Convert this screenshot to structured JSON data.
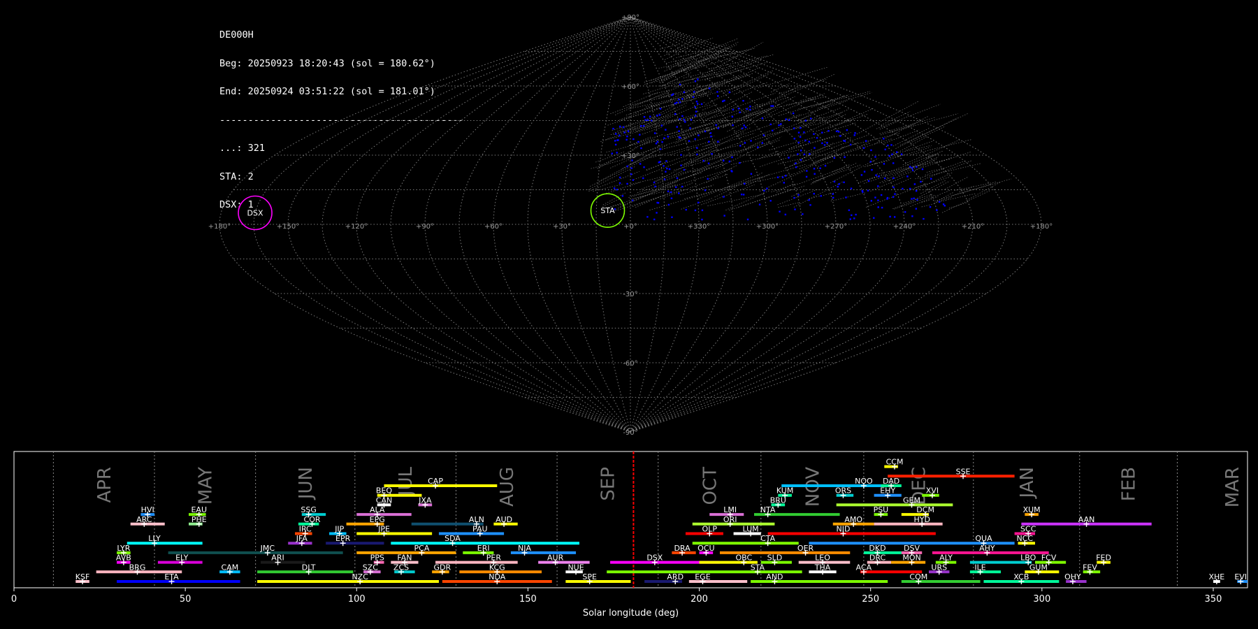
{
  "info": {
    "station": "DE000H",
    "beg": "Beg: 20250923 18:20:43 (sol = 180.62°)",
    "end": "End: 20250924 03:51:22 (sol = 181.01°)",
    "separator": "-------------------------------------------",
    "counts": [
      "...: 321",
      "STA: 2",
      "DSX: 1"
    ]
  },
  "sky_map": {
    "projection": "sinusoidal",
    "lon_labels": [
      "+180°",
      "+150°",
      "+120°",
      "+90°",
      "+60°",
      "+30°",
      "+0°",
      "+330°",
      "+300°",
      "+270°",
      "+240°",
      "+210°",
      "+180°"
    ],
    "lat_labels": [
      "+90°",
      "+60°",
      "+30°",
      "-30°",
      "-60°",
      "-90°"
    ],
    "radiants": [
      {
        "name": "DSX",
        "lon": 165,
        "lat": 5,
        "color": "#ff00ff"
      },
      {
        "name": "STA",
        "lon": 10,
        "lat": 6,
        "color": "#7fff00"
      }
    ],
    "colors": {
      "sporadic_meteor": "#0000ff",
      "grid": "#888888",
      "trail": "#999999"
    }
  },
  "chart_data": {
    "type": "timeline",
    "xlabel": "Solar longitude (deg)",
    "xlim": [
      0,
      360
    ],
    "xticks": [
      0,
      50,
      100,
      150,
      200,
      250,
      300,
      350
    ],
    "current_sol": 180.8,
    "months": [
      {
        "label": "APR",
        "start": 11.5
      },
      {
        "label": "MAY",
        "start": 41
      },
      {
        "label": "JUN",
        "start": 70.5
      },
      {
        "label": "JUL",
        "start": 99.5
      },
      {
        "label": "AUG",
        "start": 129
      },
      {
        "label": "SEP",
        "start": 158.5
      },
      {
        "label": "OCT",
        "start": 188
      },
      {
        "label": "NOV",
        "start": 218
      },
      {
        "label": "DEC",
        "start": 248
      },
      {
        "label": "JAN",
        "start": 280
      },
      {
        "label": "FEB",
        "start": 311
      },
      {
        "label": "MAR",
        "start": 339.5
      }
    ],
    "showers": [
      {
        "name": "KSF",
        "start": 18,
        "end": 22,
        "peak": 20,
        "row": 0,
        "color": "#ffc0cb"
      },
      {
        "name": "ETA",
        "start": 30,
        "end": 66,
        "peak": 46,
        "row": 0,
        "color": "#0000ff"
      },
      {
        "name": "NZC",
        "start": 71,
        "end": 124,
        "peak": 101,
        "row": 0,
        "color": "#ffff00"
      },
      {
        "name": "NDA",
        "start": 125,
        "end": 157,
        "peak": 141,
        "row": 0,
        "color": "#ff4500"
      },
      {
        "name": "SPE",
        "start": 161,
        "end": 180,
        "peak": 168,
        "row": 0,
        "color": "#ffff00"
      },
      {
        "name": "ARD",
        "start": 184,
        "end": 195,
        "peak": 193,
        "row": 0,
        "color": "#191970"
      },
      {
        "name": "EGE",
        "start": 197,
        "end": 214,
        "peak": 201,
        "row": 0,
        "color": "#ffc0cb"
      },
      {
        "name": "AND",
        "start": 215,
        "end": 255,
        "peak": 222,
        "row": 0,
        "color": "#7cfc00"
      },
      {
        "name": "COM",
        "start": 259,
        "end": 282,
        "peak": 264,
        "row": 0,
        "color": "#32cd32"
      },
      {
        "name": "XCB",
        "start": 283,
        "end": 305,
        "peak": 294,
        "row": 0,
        "color": "#00fa9a"
      },
      {
        "name": "OHY",
        "start": 307,
        "end": 313,
        "peak": 309,
        "row": 0,
        "color": "#9932cc"
      },
      {
        "name": "XHE",
        "start": 350,
        "end": 352,
        "peak": 351,
        "row": 0,
        "color": "#ffffff"
      },
      {
        "name": "EVI",
        "start": 357,
        "end": 360,
        "peak": 358,
        "row": 0,
        "color": "#1e90ff"
      },
      {
        "name": "BRG",
        "start": 24,
        "end": 49,
        "peak": 36,
        "row": 1,
        "color": "#ffb6c1"
      },
      {
        "name": "CAM",
        "start": 60,
        "end": 66,
        "peak": 63,
        "row": 1,
        "color": "#00bfff"
      },
      {
        "name": "DLT",
        "start": 71,
        "end": 99,
        "peak": 86,
        "row": 1,
        "color": "#32cd32"
      },
      {
        "name": "SZC",
        "start": 102,
        "end": 107,
        "peak": 104,
        "row": 1,
        "color": "#da70d6"
      },
      {
        "name": "ZCS",
        "start": 111,
        "end": 117,
        "peak": 113,
        "row": 1,
        "color": "#00ced1"
      },
      {
        "name": "GDR",
        "start": 122,
        "end": 127,
        "peak": 125,
        "row": 1,
        "color": "#ffa500"
      },
      {
        "name": "KCG",
        "start": 130,
        "end": 154,
        "peak": 141,
        "row": 1,
        "color": "#ff8c00"
      },
      {
        "name": "NUE",
        "start": 161,
        "end": 166,
        "peak": 164,
        "row": 1,
        "color": "#ffffff"
      },
      {
        "name": "STA",
        "start": 173,
        "end": 230,
        "peak": 217,
        "row": 1,
        "color": "#7cfc00"
      },
      {
        "name": "THA",
        "start": 232,
        "end": 240,
        "peak": 236,
        "row": 1,
        "color": "#ffffff"
      },
      {
        "name": "ACA",
        "start": 247,
        "end": 265,
        "peak": 248,
        "row": 1,
        "color": "#ff0000"
      },
      {
        "name": "URS",
        "start": 267,
        "end": 273,
        "peak": 270,
        "row": 1,
        "color": "#9932cc"
      },
      {
        "name": "ILE",
        "start": 279,
        "end": 288,
        "peak": 282,
        "row": 1,
        "color": "#00fa9a"
      },
      {
        "name": "GUM",
        "start": 295,
        "end": 305,
        "peak": 299,
        "row": 1,
        "color": "#ffff00"
      },
      {
        "name": "FEV",
        "start": 312,
        "end": 317,
        "peak": 314,
        "row": 1,
        "color": "#7fff00"
      },
      {
        "name": "AVB",
        "start": 30,
        "end": 34,
        "peak": 32,
        "row": 2,
        "color": "#ff00ff"
      },
      {
        "name": "ELY",
        "start": 42,
        "end": 55,
        "peak": 49,
        "row": 2,
        "color": "#da00da"
      },
      {
        "name": "ARI",
        "start": 72,
        "end": 85,
        "peak": 77,
        "row": 2,
        "color": "#1a1a1a"
      },
      {
        "name": "PPS",
        "start": 105,
        "end": 108,
        "peak": 106,
        "row": 2,
        "color": "#ff69b4"
      },
      {
        "name": "FAN",
        "start": 110,
        "end": 118,
        "peak": 114,
        "row": 2,
        "color": "#ffc0cb"
      },
      {
        "name": "PER",
        "start": 123,
        "end": 147,
        "peak": 140,
        "row": 2,
        "color": "#ffb6c1"
      },
      {
        "name": "AUR",
        "start": 153,
        "end": 168,
        "peak": 158,
        "row": 2,
        "color": "#ee82ee"
      },
      {
        "name": "DSX",
        "start": 174,
        "end": 206,
        "peak": 187,
        "row": 2,
        "color": "#ff00ff"
      },
      {
        "name": "OBC",
        "start": 200,
        "end": 217,
        "peak": 213,
        "row": 2,
        "color": "#ffff00"
      },
      {
        "name": "SLD",
        "start": 218,
        "end": 227,
        "peak": 222,
        "row": 2,
        "color": "#7cfc00"
      },
      {
        "name": "LEO",
        "start": 229,
        "end": 244,
        "peak": 236,
        "row": 2,
        "color": "#ffc0cb"
      },
      {
        "name": "DRC",
        "start": 249,
        "end": 256,
        "peak": 252,
        "row": 2,
        "color": "#ffb6c1"
      },
      {
        "name": "MON",
        "start": 256,
        "end": 266,
        "peak": 262,
        "row": 2,
        "color": "#ffa500"
      },
      {
        "name": "ALY",
        "start": 269,
        "end": 275,
        "peak": 272,
        "row": 2,
        "color": "#7cfc00"
      },
      {
        "name": "LBO",
        "start": 279,
        "end": 297,
        "peak": 296,
        "row": 2,
        "color": "#00ced1"
      },
      {
        "name": "FCV",
        "start": 298,
        "end": 307,
        "peak": 302,
        "row": 2,
        "color": "#7fff00"
      },
      {
        "name": "FED",
        "start": 316,
        "end": 320,
        "peak": 318,
        "row": 2,
        "color": "#ffff00"
      },
      {
        "name": "LYR",
        "start": 30,
        "end": 34,
        "peak": 32,
        "row": 3,
        "color": "#7fff00"
      },
      {
        "name": "JMC",
        "start": 45,
        "end": 96,
        "peak": 74,
        "row": 3,
        "color": "#0f4f4f"
      },
      {
        "name": "PCA",
        "start": 100,
        "end": 129,
        "peak": 119,
        "row": 3,
        "color": "#ffa500"
      },
      {
        "name": "ERI",
        "start": 131,
        "end": 140,
        "peak": 137,
        "row": 3,
        "color": "#7cfc00"
      },
      {
        "name": "NIA",
        "start": 145,
        "end": 164,
        "peak": 149,
        "row": 3,
        "color": "#1e90ff"
      },
      {
        "name": "DRA",
        "start": 192,
        "end": 199,
        "peak": 195,
        "row": 3,
        "color": "#ff4500"
      },
      {
        "name": "OCU",
        "start": 200,
        "end": 204,
        "peak": 202,
        "row": 3,
        "color": "#ff00ff"
      },
      {
        "name": "OER",
        "start": 206,
        "end": 244,
        "peak": 231,
        "row": 3,
        "color": "#ff8c00"
      },
      {
        "name": "DKD",
        "start": 248,
        "end": 259,
        "peak": 252,
        "row": 3,
        "color": "#00fa9a"
      },
      {
        "name": "DSV",
        "start": 259,
        "end": 265,
        "peak": 262,
        "row": 3,
        "color": "#ff69b4"
      },
      {
        "name": "AHY",
        "start": 268,
        "end": 302,
        "peak": 284,
        "row": 3,
        "color": "#ff1493"
      },
      {
        "name": "LLY",
        "start": 33,
        "end": 55,
        "peak": 41,
        "row": 4,
        "color": "#00ffff"
      },
      {
        "name": "JFA",
        "start": 80,
        "end": 87,
        "peak": 84,
        "row": 4,
        "color": "#9932cc"
      },
      {
        "name": "EPR",
        "start": 91,
        "end": 108,
        "peak": 96,
        "row": 4,
        "color": "#191970"
      },
      {
        "name": "SDA",
        "start": 110,
        "end": 165,
        "peak": 128,
        "row": 4,
        "color": "#00ffff"
      },
      {
        "name": "CTA",
        "start": 198,
        "end": 229,
        "peak": 220,
        "row": 4,
        "color": "#7fff00"
      },
      {
        "name": "QUA",
        "start": 232,
        "end": 292,
        "peak": 283,
        "row": 4,
        "color": "#1e90ff"
      },
      {
        "name": "NCC",
        "start": 293,
        "end": 298,
        "peak": 295,
        "row": 4,
        "color": "#ffff00"
      },
      {
        "name": "IRC",
        "start": 82,
        "end": 87,
        "peak": 85,
        "row": 5,
        "color": "#ff4500"
      },
      {
        "name": "JIP",
        "start": 92,
        "end": 97,
        "peak": 95,
        "row": 5,
        "color": "#00bfff"
      },
      {
        "name": "JPE",
        "start": 100,
        "end": 122,
        "peak": 108,
        "row": 5,
        "color": "#ffff00"
      },
      {
        "name": "PAU",
        "start": 124,
        "end": 143,
        "peak": 136,
        "row": 5,
        "color": "#1e90ff"
      },
      {
        "name": "OLP",
        "start": 196,
        "end": 207,
        "peak": 203,
        "row": 5,
        "color": "#ff0000"
      },
      {
        "name": "LUM",
        "start": 210,
        "end": 218,
        "peak": 215,
        "row": 5,
        "color": "#ffffff"
      },
      {
        "name": "NID",
        "start": 220,
        "end": 269,
        "peak": 242,
        "row": 5,
        "color": "#ff0000"
      },
      {
        "name": "SCC",
        "start": 292,
        "end": 298,
        "peak": 296,
        "row": 5,
        "color": "#ff1493"
      },
      {
        "name": "ARC",
        "start": 34,
        "end": 44,
        "peak": 38,
        "row": 6,
        "color": "#ffc0cb"
      },
      {
        "name": "PHE",
        "start": 51,
        "end": 55,
        "peak": 54,
        "row": 6,
        "color": "#90ee90"
      },
      {
        "name": "COR",
        "start": 83,
        "end": 89,
        "peak": 87,
        "row": 6,
        "color": "#00fa9a"
      },
      {
        "name": "EPG",
        "start": 97,
        "end": 108,
        "peak": 106,
        "row": 6,
        "color": "#ffa500"
      },
      {
        "name": "ALN",
        "start": 116,
        "end": 137,
        "peak": 135,
        "row": 6,
        "color": "#0f4f6f"
      },
      {
        "name": "AUD",
        "start": 140,
        "end": 147,
        "peak": 143,
        "row": 6,
        "color": "#ffff00"
      },
      {
        "name": "ORI",
        "start": 198,
        "end": 222,
        "peak": 209,
        "row": 6,
        "color": "#adff2f"
      },
      {
        "name": "AMO",
        "start": 239,
        "end": 251,
        "peak": 245,
        "row": 6,
        "color": "#ffa500"
      },
      {
        "name": "HYD",
        "start": 251,
        "end": 271,
        "peak": 265,
        "row": 6,
        "color": "#ffb6c1"
      },
      {
        "name": "AAN",
        "start": 294,
        "end": 332,
        "peak": 313,
        "row": 6,
        "color": "#cc33ff"
      },
      {
        "name": "HVI",
        "start": 37,
        "end": 41,
        "peak": 39,
        "row": 7,
        "color": "#1e90ff"
      },
      {
        "name": "EAU",
        "start": 51,
        "end": 56,
        "peak": 54,
        "row": 7,
        "color": "#7cfc00"
      },
      {
        "name": "SSG",
        "start": 84,
        "end": 91,
        "peak": 86,
        "row": 7,
        "color": "#00ced1"
      },
      {
        "name": "ALA",
        "start": 100,
        "end": 116,
        "peak": 106,
        "row": 7,
        "color": "#da70d6"
      },
      {
        "name": "LMI",
        "start": 203,
        "end": 213,
        "peak": 209,
        "row": 7,
        "color": "#da70d6"
      },
      {
        "name": "NTA",
        "start": 216,
        "end": 241,
        "peak": 220,
        "row": 7,
        "color": "#32cd32"
      },
      {
        "name": "PSU",
        "start": 251,
        "end": 255,
        "peak": 253,
        "row": 7,
        "color": "#7cfc00"
      },
      {
        "name": "DCM",
        "start": 259,
        "end": 267,
        "peak": 266,
        "row": 7,
        "color": "#ffff00"
      },
      {
        "name": "XUM",
        "start": 295,
        "end": 299,
        "peak": 297,
        "row": 7,
        "color": "#ffa500"
      },
      {
        "name": "BRU",
        "start": 221,
        "end": 225,
        "peak": 223,
        "row": 8,
        "color": "#00fa9a"
      },
      {
        "name": "CAN",
        "start": 106,
        "end": 110,
        "peak": 108,
        "row": 8,
        "color": "#ffffff"
      },
      {
        "name": "JXA",
        "start": 118,
        "end": 122,
        "peak": 120,
        "row": 8,
        "color": "#da70d6"
      },
      {
        "name": "GEM",
        "start": 240,
        "end": 274,
        "peak": 262,
        "row": 8,
        "color": "#adff2f"
      },
      {
        "name": "BEQ",
        "start": 106,
        "end": 119,
        "peak": 108,
        "row": 9,
        "color": "#ffff00"
      },
      {
        "name": "KUM",
        "start": 223,
        "end": 227,
        "peak": 225,
        "row": 9,
        "color": "#00fa9a"
      },
      {
        "name": "ORS",
        "start": 240,
        "end": 245,
        "peak": 242,
        "row": 9,
        "color": "#00ced1"
      },
      {
        "name": "EHY",
        "start": 251,
        "end": 259,
        "peak": 255,
        "row": 9,
        "color": "#1e90ff"
      },
      {
        "name": "XVI",
        "start": 265,
        "end": 270,
        "peak": 268,
        "row": 9,
        "color": "#7cfc00"
      },
      {
        "name": "CAP",
        "start": 108,
        "end": 141,
        "peak": 123,
        "row": 10,
        "color": "#ffff00"
      },
      {
        "name": "NOO",
        "start": 224,
        "end": 257,
        "peak": 248,
        "row": 10,
        "color": "#00bfff"
      },
      {
        "name": "DAD",
        "start": 253,
        "end": 259,
        "peak": 256,
        "row": 10,
        "color": "#00fa9a"
      },
      {
        "name": "SSE",
        "start": 255,
        "end": 292,
        "peak": 277,
        "row": 11,
        "color": "#ff2000"
      },
      {
        "name": "CCM",
        "start": 254,
        "end": 258,
        "peak": 257,
        "row": 12,
        "color": "#ffff00"
      }
    ]
  }
}
